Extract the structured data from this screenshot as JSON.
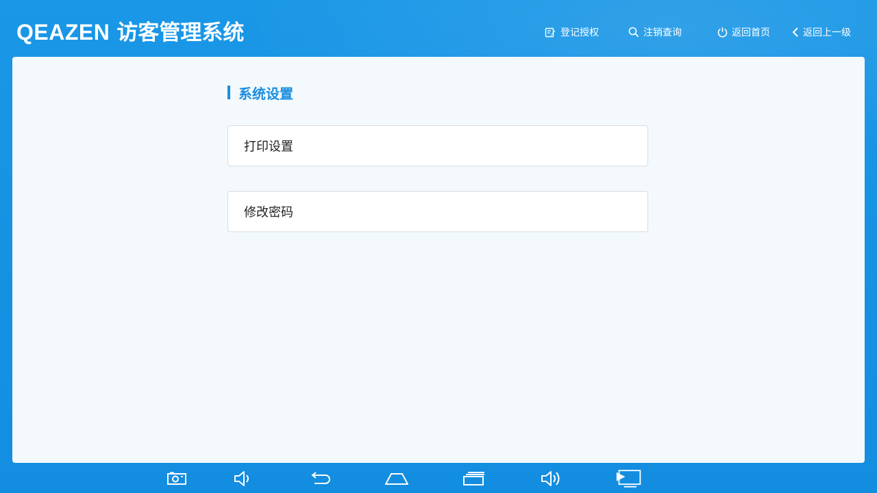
{
  "header": {
    "brand": "QEAZEN",
    "title": "访客管理系统",
    "nav": {
      "register": "登记授权",
      "cancel_query": "注销查询",
      "home": "返回首页",
      "back": "返回上一级"
    }
  },
  "main": {
    "section_title": "系统设置",
    "items": [
      {
        "label": "打印设置"
      },
      {
        "label": "修改密码"
      }
    ]
  },
  "system_bar": {
    "icons": [
      "screenshot-icon",
      "volume-down-icon",
      "back-icon",
      "home-icon",
      "recent-apps-icon",
      "volume-up-icon",
      "screen-cast-icon"
    ]
  },
  "colors": {
    "primary": "#1591e3",
    "accent_text": "#1a8de0",
    "panel_bg": "#f3f9fc"
  }
}
